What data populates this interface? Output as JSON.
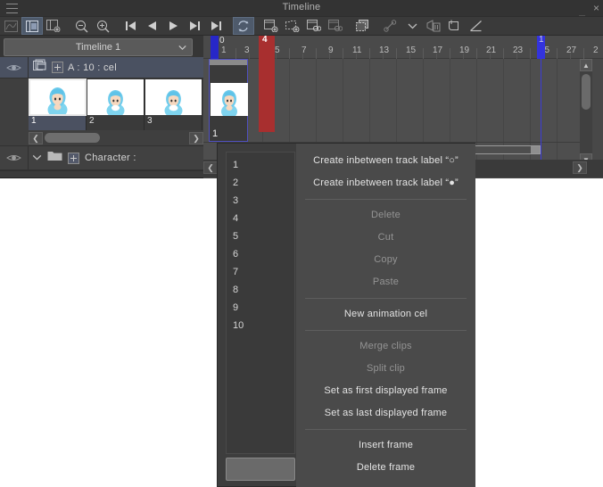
{
  "window": {
    "title": "Timeline",
    "menu_icon": "hamburger-icon",
    "minimize_label": "_",
    "close_label": "×"
  },
  "toolbar": {
    "buttons": [
      {
        "name": "edit-timeline-icon",
        "label": "Edit timeline",
        "state": "disabled"
      },
      {
        "name": "enable-timeline-icon",
        "label": "Enable timeline",
        "state": "active"
      },
      {
        "name": "new-timeline-icon",
        "label": "New timeline",
        "state": "normal"
      },
      {
        "name": "zoom-out-icon",
        "label": "Zoom out",
        "state": "normal"
      },
      {
        "name": "zoom-in-icon",
        "label": "Zoom in",
        "state": "normal"
      },
      {
        "name": "go-to-start-icon",
        "label": "Go to start frame",
        "state": "normal"
      },
      {
        "name": "previous-frame-icon",
        "label": "Previous frame",
        "state": "normal"
      },
      {
        "name": "play-stop-icon",
        "label": "Play/Stop",
        "state": "normal"
      },
      {
        "name": "next-frame-icon",
        "label": "Next frame",
        "state": "normal"
      },
      {
        "name": "go-to-end-icon",
        "label": "Go to end frame",
        "state": "normal"
      },
      {
        "name": "loop-playback-icon",
        "label": "Loop playback",
        "state": "active"
      },
      {
        "name": "new-animation-cel-icon",
        "label": "New animation cel",
        "state": "normal"
      },
      {
        "name": "new-animation-folder-icon",
        "label": "New animation folder",
        "state": "normal"
      },
      {
        "name": "specify-cels-icon",
        "label": "Specify cels",
        "state": "normal"
      },
      {
        "name": "clear-cels-icon",
        "label": "Clear cels",
        "state": "disabled"
      },
      {
        "name": "duplicate-cel-icon",
        "label": "Duplicate cel",
        "state": "normal"
      },
      {
        "name": "enable-keyframe-icon",
        "label": "Enable keyframes on this layer",
        "state": "disabled"
      },
      {
        "name": "chevron-down-icon",
        "label": "Interpolation options",
        "state": "normal"
      },
      {
        "name": "delete-keyframe-icon",
        "label": "Delete keyframe",
        "state": "disabled"
      },
      {
        "name": "copy-keyframe-icon",
        "label": "Copy keyframe",
        "state": "normal"
      },
      {
        "name": "linear-interpolation-icon",
        "label": "Linear interpolation",
        "state": "normal"
      }
    ]
  },
  "timeline_selector": {
    "value": "Timeline 1",
    "chevron": "chevron-down-icon"
  },
  "tracks": {
    "cel_track": {
      "visibility_icon": "eye-icon",
      "layers_icon": "layers-icon",
      "expand_icon": "plus-box-icon",
      "label": "A : 10 : cel",
      "cels": [
        {
          "number": "1",
          "selected": true
        },
        {
          "number": "2",
          "selected": false
        },
        {
          "number": "3",
          "selected": false
        }
      ],
      "scroll_left_icon": "chevron-left-icon",
      "scroll_right_icon": "chevron-right-icon"
    },
    "folder_track": {
      "visibility_icon": "eye-icon",
      "collapse_icon": "chevron-down-icon",
      "folder_icon": "folder-icon",
      "expand_icon": "plus-box-icon",
      "label": "Character :"
    }
  },
  "ruler": {
    "zero_label": "0",
    "ticks": [
      "1",
      "3",
      "5",
      "7",
      "9",
      "11",
      "13",
      "15",
      "17",
      "19",
      "21",
      "23",
      "25",
      "27",
      "2"
    ],
    "playhead_frame": "4",
    "end_marker_label": "1"
  },
  "timeline_cel_block": {
    "number": "1"
  },
  "scrollbars": {
    "vertical_up_icon": "chevron-up-icon",
    "vertical_down_icon": "chevron-down-icon",
    "horizontal_left_icon": "chevron-left-icon",
    "horizontal_right_icon": "chevron-right-icon"
  },
  "context_menu": {
    "frame_numbers": [
      "1",
      "2",
      "3",
      "4",
      "5",
      "6",
      "7",
      "8",
      "9",
      "10"
    ],
    "items": [
      {
        "label": "Create inbetween track label “○”",
        "disabled": false
      },
      {
        "label": "Create inbetween track label “●”",
        "disabled": false
      },
      {
        "separator": true
      },
      {
        "label": "Delete",
        "disabled": true
      },
      {
        "label": "Cut",
        "disabled": true
      },
      {
        "label": "Copy",
        "disabled": true
      },
      {
        "label": "Paste",
        "disabled": true
      },
      {
        "separator": true
      },
      {
        "label": "New animation cel",
        "disabled": false
      },
      {
        "separator": true
      },
      {
        "label": "Merge clips",
        "disabled": true
      },
      {
        "label": "Split clip",
        "disabled": true
      },
      {
        "label": "Set as first displayed frame",
        "disabled": false
      },
      {
        "label": "Set as last displayed frame",
        "disabled": false
      },
      {
        "separator": true
      },
      {
        "label": "Insert frame",
        "disabled": false
      },
      {
        "label": "Delete frame",
        "disabled": false
      }
    ]
  },
  "colors": {
    "accent_blue": "#3333dd",
    "playhead_red": "#a82f2f",
    "panel_bg": "#3f3f3f",
    "menu_bg": "#4a4a4a",
    "selection_blue": "#4a5161"
  }
}
